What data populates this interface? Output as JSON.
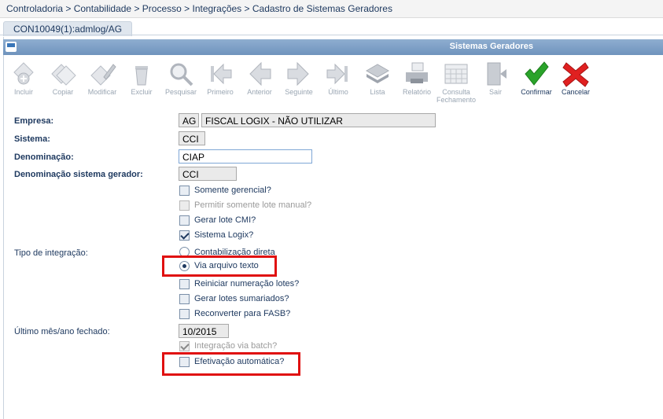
{
  "breadcrumb": "Controladoria > Contabilidade > Processo > Integrações > Cadastro de Sistemas Geradores",
  "tab": "CON10049(1):admlog/AG",
  "window_title": "Sistemas Geradores",
  "toolbar": [
    {
      "label": "Incluir",
      "icon": "add-icon",
      "enabled": false
    },
    {
      "label": "Copiar",
      "icon": "copy-icon",
      "enabled": false
    },
    {
      "label": "Modificar",
      "icon": "edit-icon",
      "enabled": false
    },
    {
      "label": "Excluir",
      "icon": "trash-icon",
      "enabled": false
    },
    {
      "label": "Pesquisar",
      "icon": "search-icon",
      "enabled": false
    },
    {
      "label": "Primeiro",
      "icon": "first-icon",
      "enabled": false
    },
    {
      "label": "Anterior",
      "icon": "previous-icon",
      "enabled": false
    },
    {
      "label": "Seguinte",
      "icon": "next-icon",
      "enabled": false
    },
    {
      "label": "Último",
      "icon": "last-icon",
      "enabled": false
    },
    {
      "label": "Lista",
      "icon": "list-icon",
      "enabled": false
    },
    {
      "label": "Relatório",
      "icon": "printer-icon",
      "enabled": false
    },
    {
      "label": "Consulta Fechamento",
      "icon": "calendar-icon",
      "enabled": false
    },
    {
      "label": "Sair",
      "icon": "exit-icon",
      "enabled": false
    },
    {
      "label": "Confirmar",
      "icon": "check-icon",
      "enabled": true
    },
    {
      "label": "Cancelar",
      "icon": "cancel-icon",
      "enabled": true
    }
  ],
  "colors": {
    "accent": "#6f93bd",
    "confirm": "#2aa32a",
    "cancel": "#e02020",
    "highlight": "#e01010"
  },
  "form": {
    "empresa": {
      "label": "Empresa:",
      "code": "AG",
      "name": "FISCAL LOGIX - NÃO UTILIZAR"
    },
    "sistema": {
      "label": "Sistema:",
      "value": "CCI"
    },
    "denominacao": {
      "label": "Denominação:",
      "value": "CIAP"
    },
    "denominacao_gerador": {
      "label": "Denominação sistema gerador:",
      "value": "CCI"
    },
    "checks1": [
      {
        "label": "Somente gerencial?",
        "checked": false,
        "disabled": false
      },
      {
        "label": "Permitir somente lote manual?",
        "checked": false,
        "disabled": true
      },
      {
        "label": "Gerar lote CMI?",
        "checked": false,
        "disabled": false
      },
      {
        "label": "Sistema Logix?",
        "checked": true,
        "disabled": false
      }
    ],
    "tipo_integracao": {
      "label": "Tipo de integração:",
      "options": [
        {
          "label": "Contabilização direta",
          "selected": false
        },
        {
          "label": "Via arquivo texto",
          "selected": true
        }
      ]
    },
    "checks2": [
      {
        "label": "Reiniciar numeração lotes?",
        "checked": false,
        "disabled": false
      },
      {
        "label": "Gerar lotes sumariados?",
        "checked": false,
        "disabled": false
      },
      {
        "label": "Reconverter para FASB?",
        "checked": false,
        "disabled": false
      }
    ],
    "ultimo_mes": {
      "label": "Último mês/ano fechado:",
      "value": "10/2015"
    },
    "checks3": [
      {
        "label": "Integração via batch?",
        "checked": true,
        "disabled": true
      },
      {
        "label": "Efetivação automática?",
        "checked": false,
        "disabled": false
      }
    ]
  }
}
